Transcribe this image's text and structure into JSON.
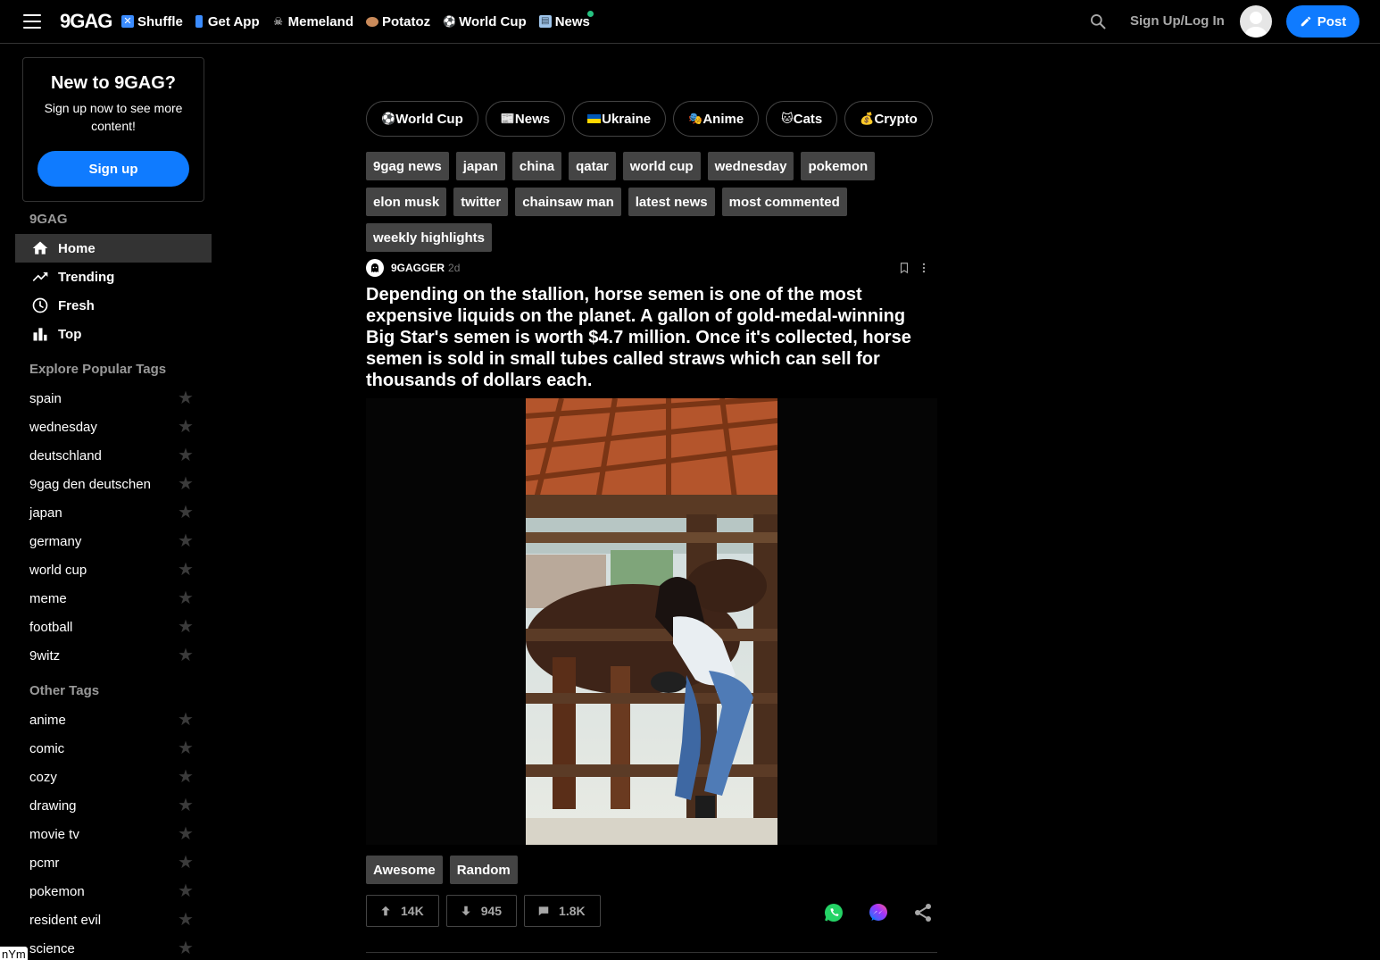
{
  "topnav": {
    "logo": "9GAG",
    "links": [
      {
        "label": "Shuffle",
        "icon": "shuffle-icon"
      },
      {
        "label": "Get App",
        "icon": "phone-icon"
      },
      {
        "label": "Memeland",
        "icon": "pirate-flag-icon"
      },
      {
        "label": "Potatoz",
        "icon": "potato-icon"
      },
      {
        "label": "World Cup",
        "icon": "soccer-ball-icon"
      },
      {
        "label": "News",
        "icon": "newspaper-icon"
      }
    ],
    "login_label": "Sign Up/Log In",
    "post_label": "Post"
  },
  "sidebar": {
    "signup": {
      "title": "New to 9GAG?",
      "text": "Sign up now to see more content!",
      "button": "Sign up"
    },
    "section_9gag": "9GAG",
    "nav": [
      {
        "label": "Home",
        "icon": "home-icon"
      },
      {
        "label": "Trending",
        "icon": "trending-icon"
      },
      {
        "label": "Fresh",
        "icon": "clock-icon"
      },
      {
        "label": "Top",
        "icon": "bar-chart-icon"
      }
    ],
    "popular_title": "Explore Popular Tags",
    "popular_tags": [
      "spain",
      "wednesday",
      "deutschland",
      "9gag den deutschen",
      "japan",
      "germany",
      "world cup",
      "meme",
      "football",
      "9witz"
    ],
    "other_title": "Other Tags",
    "other_tags": [
      "anime",
      "comic",
      "cozy",
      "drawing",
      "movie tv",
      "pcmr",
      "pokemon",
      "resident evil",
      "science"
    ],
    "corner_text": "nYm"
  },
  "main": {
    "chips": [
      {
        "icon": "⚽",
        "label": "World Cup"
      },
      {
        "icon": "📰",
        "label": "News"
      },
      {
        "icon": "🇺🇦",
        "label": "Ukraine"
      },
      {
        "icon": "🎭",
        "label": "Anime"
      },
      {
        "icon": "🐱",
        "label": "Cats"
      },
      {
        "icon": "💰",
        "label": "Crypto"
      },
      {
        "icon": "🎮",
        "label": ""
      }
    ],
    "tags": [
      "9gag news",
      "japan",
      "china",
      "qatar",
      "world cup",
      "wednesday",
      "pokemon",
      "elon musk",
      "twitter",
      "chainsaw man",
      "latest news",
      "most commented",
      "weekly highlights"
    ],
    "post": {
      "author": "9GAGGER",
      "time": "2d",
      "title": "Depending on the stallion, horse semen is one of the most expensive liquids on the planet. A gallon of gold-medal-winning Big Star's semen is worth $4.7 million. Once it's collected, horse semen is sold in small tubes called straws which can sell for thousands of dollars each.",
      "tags": [
        "Awesome",
        "Random"
      ],
      "upvotes": "14K",
      "downvotes": "945",
      "comments": "1.8K"
    }
  },
  "colors": {
    "accent": "#0f7bff",
    "background": "#000000",
    "tag_bg": "#444444",
    "whatsapp": "#25d366",
    "messenger": "#a334fa"
  }
}
